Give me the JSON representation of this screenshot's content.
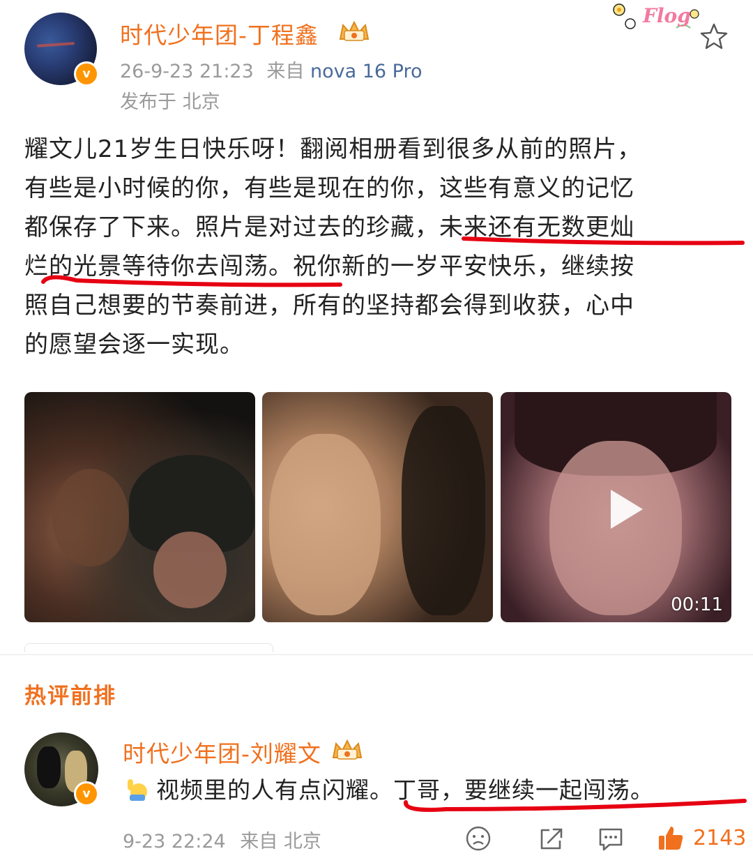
{
  "post": {
    "author": "时代少年团-丁程鑫",
    "time": "26-9-23 21:23",
    "source_prefix": "来自",
    "device": "nova 16 Pro",
    "location": "发布于 北京",
    "text_lines": [
      "耀文儿21岁生日快乐呀！翻阅相册看到很多从前的照片，",
      "有些是小时候的你，有些是现在的你，这些有意义的记忆",
      "都保存了下来。照片是对过去的珍藏，未来还有无数更灿",
      "烂的光景等待你去闯荡。祝你新的一岁平安快乐，继续按",
      "照自己想要的节奏前进，所有的坚持都会得到收获，心中",
      "的愿望会逐一实现。"
    ],
    "video_duration": "00:11"
  },
  "sticker_text": "Flog",
  "hot_comments_title": "热评前排",
  "comment": {
    "author": "时代少年团-刘耀文",
    "text": "视频里的人有点闪耀。丁哥，要继续一起闯荡。",
    "time": "9-23 22:24",
    "source": "来自 北京",
    "likes": "2143"
  },
  "colors": {
    "accent": "#f0701e",
    "verified": "#ff9500",
    "annotation": "#e60012",
    "device": "#4a6a9a"
  }
}
